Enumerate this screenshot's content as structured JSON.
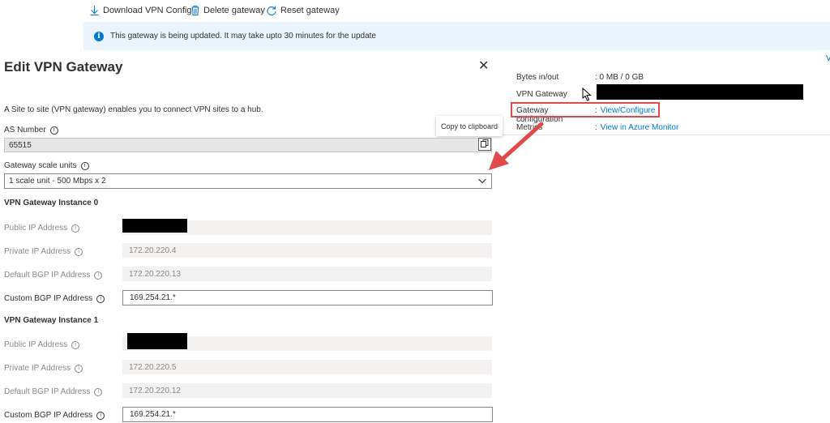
{
  "toolbar": {
    "download_label": "Download VPN Config",
    "delete_label": "Delete gateway",
    "reset_label": "Reset gateway"
  },
  "banner": {
    "text": "This gateway is being updated. It may take upto 30 minutes for the update"
  },
  "overview": {
    "bytes_label": "Bytes in/out",
    "bytes_value": ": 0 MB / 0 GB",
    "vpn_gateway_label": "VPN Gateway",
    "gateway_config_label": "Gateway configuration",
    "gateway_config_sep": ":",
    "gateway_config_link": "View/Configure",
    "metrics_label": "Metrics",
    "metrics_sep": ":",
    "metrics_link": "View in Azure Monitor",
    "top_right_glyph": "V"
  },
  "tooltip": {
    "text": "Copy to clipboard"
  },
  "panel": {
    "title": "Edit VPN Gateway",
    "close_glyph": "✕",
    "description": "A Site to site (VPN gateway) enables you to connect VPN sites to a hub.",
    "as_number_label": "AS Number",
    "as_number_value": "65515",
    "scale_units_label": "Gateway scale units",
    "scale_units_value": "1 scale unit - 500 Mbps x 2",
    "instance0": {
      "heading": "VPN Gateway Instance 0",
      "public_ip_label": "Public IP Address",
      "private_ip_label": "Private IP Address",
      "private_ip_value": "172.20.220.4",
      "default_bgp_label": "Default BGP IP Address",
      "default_bgp_value": "172.20.220.13",
      "custom_bgp_label": "Custom BGP IP Address",
      "custom_bgp_value": "169.254.21.*"
    },
    "instance1": {
      "heading": "VPN Gateway Instance 1",
      "public_ip_label": "Public IP Address",
      "private_ip_label": "Private IP Address",
      "private_ip_value": "172.20.220.5",
      "default_bgp_label": "Default BGP IP Address",
      "default_bgp_value": "172.20.220.12",
      "custom_bgp_label": "Custom BGP IP Address",
      "custom_bgp_value": "169.254.21.*"
    }
  },
  "colors": {
    "accent": "#0078d4",
    "highlight_red": "#e04a4a",
    "banner_bg": "#ebf3fc"
  },
  "icons": [
    "download-icon",
    "trash-icon",
    "refresh-icon",
    "info-icon",
    "copy-icon",
    "chevron-down-icon",
    "close-icon",
    "pointer-cursor-icon",
    "red-arrow-icon"
  ]
}
